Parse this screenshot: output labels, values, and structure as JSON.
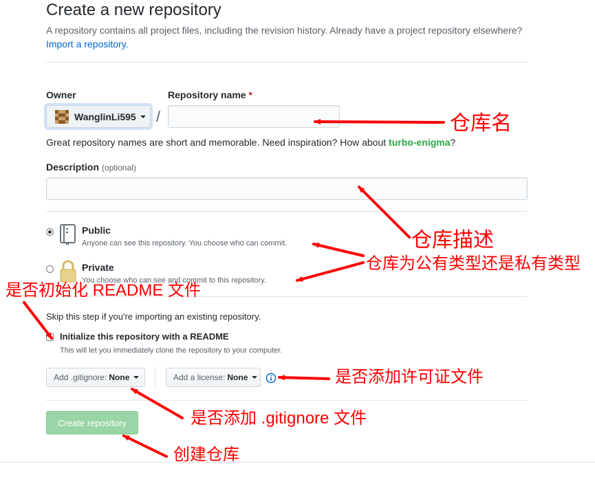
{
  "header": {
    "title": "Create a new repository",
    "subtitle": "A repository contains all project files, including the revision history. Already have a project repository elsewhere?",
    "import_link": "Import a repository."
  },
  "owner": {
    "label": "Owner",
    "name": "WanglinLi595"
  },
  "repo_name": {
    "label": "Repository name",
    "required_mark": "*",
    "value": "",
    "separator": "/"
  },
  "name_hint": {
    "prefix": "Great repository names are short and memorable. Need inspiration? How about ",
    "suggestion": "turbo-enigma",
    "suffix": "?"
  },
  "description": {
    "label": "Description",
    "optional": "(optional)",
    "value": ""
  },
  "visibility": {
    "selected": "public",
    "public": {
      "title": "Public",
      "desc": "Anyone can see this repository. You choose who can commit."
    },
    "private": {
      "title": "Private",
      "desc": "You choose who can see and commit to this repository."
    }
  },
  "init": {
    "skip_text": "Skip this step if you're importing an existing repository.",
    "readme_label": "Initialize this repository with a README",
    "readme_desc": "This will let you immediately clone the repository to your computer.",
    "readme_checked": false
  },
  "gitignore": {
    "label": "Add .gitignore:",
    "value": "None"
  },
  "license": {
    "label": "Add a license:",
    "value": "None"
  },
  "create_button": "Create repository",
  "annotations": {
    "repo_name": "仓库名",
    "description": "仓库描述",
    "visibility": "仓库为公有类型还是私有类型",
    "readme": "是否初始化 README 文件",
    "license": "是否添加许可证文件",
    "gitignore": "是否添加 .gitignore 文件",
    "create": "创建仓库"
  },
  "colors": {
    "link": "#0366d6",
    "suggestion": "#28a745",
    "create_button": "#94d3a2",
    "annotation": "#ff0000",
    "required": "#cb2431"
  }
}
